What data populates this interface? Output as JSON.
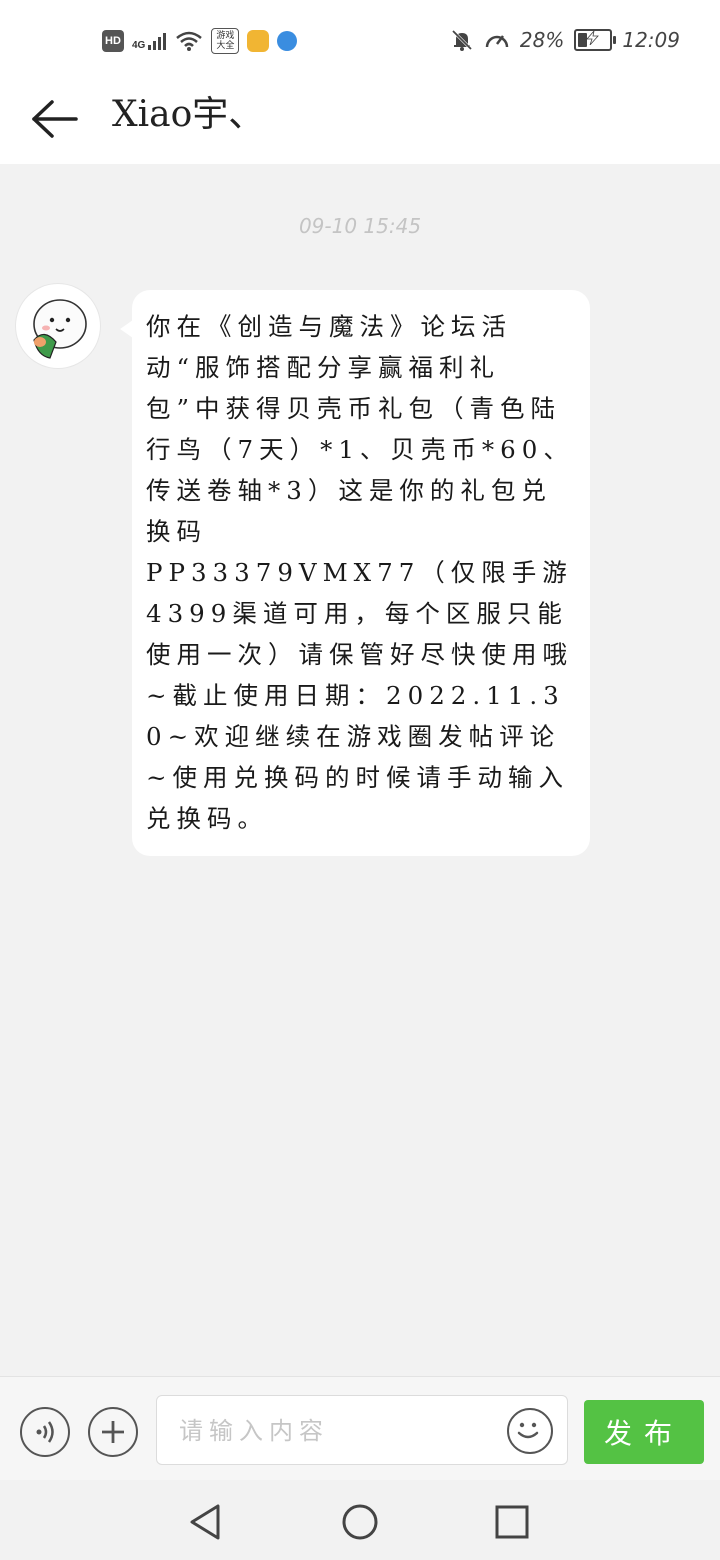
{
  "status_bar": {
    "hd": "HD",
    "network": "4G",
    "app_badge_text": "游戏大全",
    "battery_percent": "28%",
    "time": "12:09",
    "battery_level": 0.28
  },
  "header": {
    "title": "Xiao宇、"
  },
  "chat": {
    "timestamp": "09-10 15:45",
    "message": "你在《创造与魔法》论坛活动“服饰搭配分享赢福利礼包”中获得贝壳币礼包（青色陆行鸟（7天）*1、贝壳币*60、传送卷轴*3）这是你的礼包兑换码\nPP33379VMX77（仅限手游4399渠道可用，每个区服只能使用一次）请保管好尽快使用哦~截止使用日期：2022.11.30~欢迎继续在游戏圈发帖评论~使用兑换码的时候请手动输入兑换码。"
  },
  "input_bar": {
    "placeholder": "请输入内容",
    "publish_label": "发布"
  },
  "icons": {
    "back": "arrow-left-icon",
    "voice": "voice-icon",
    "plus": "plus-icon",
    "emoji": "smiley-icon",
    "nav_back": "triangle-back-icon",
    "nav_home": "circle-home-icon",
    "nav_recent": "square-recent-icon"
  },
  "colors": {
    "publish_green": "#54c244",
    "background": "#f2f2f2"
  }
}
